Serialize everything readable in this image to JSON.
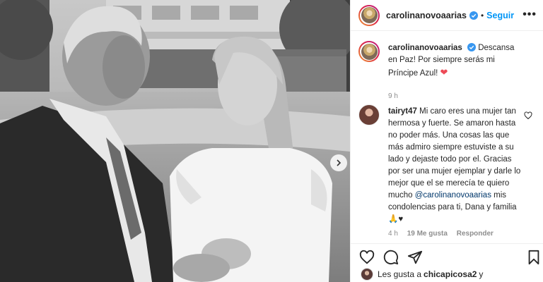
{
  "post": {
    "username": "carolinanovoaarias",
    "follow_label": "Seguir",
    "separator": "•",
    "more_label": "•••"
  },
  "caption": {
    "username": "carolinanovoaarias",
    "text": "Descansa en Paz! Por siempre serás mi Príncipe Azul!",
    "heart": "❤",
    "time": "9 h"
  },
  "comment": {
    "username": "tairyt47",
    "text_before": "Mi caro eres una mujer tan hermosa y fuerte. Se amaron hasta no poder más. Una cosas las que más admiro siempre estuviste a su lado y dejaste todo por el. Gracias por ser una mujer ejemplar y darle lo mejor que el se merecía te quiero mucho",
    "mention": "@carolinanovoaarias",
    "text_after": "mis condolencias para ti, Dana y familia 🙏♥",
    "time": "4 h",
    "likes": "19 Me gusta",
    "reply": "Responder"
  },
  "likes_line": {
    "prefix": "Les gusta a",
    "user": "chicapicosa2",
    "suffix": "y"
  },
  "colors": {
    "accent": "#0095f6",
    "verified": "#3897f0",
    "heart": "#ed4956"
  }
}
